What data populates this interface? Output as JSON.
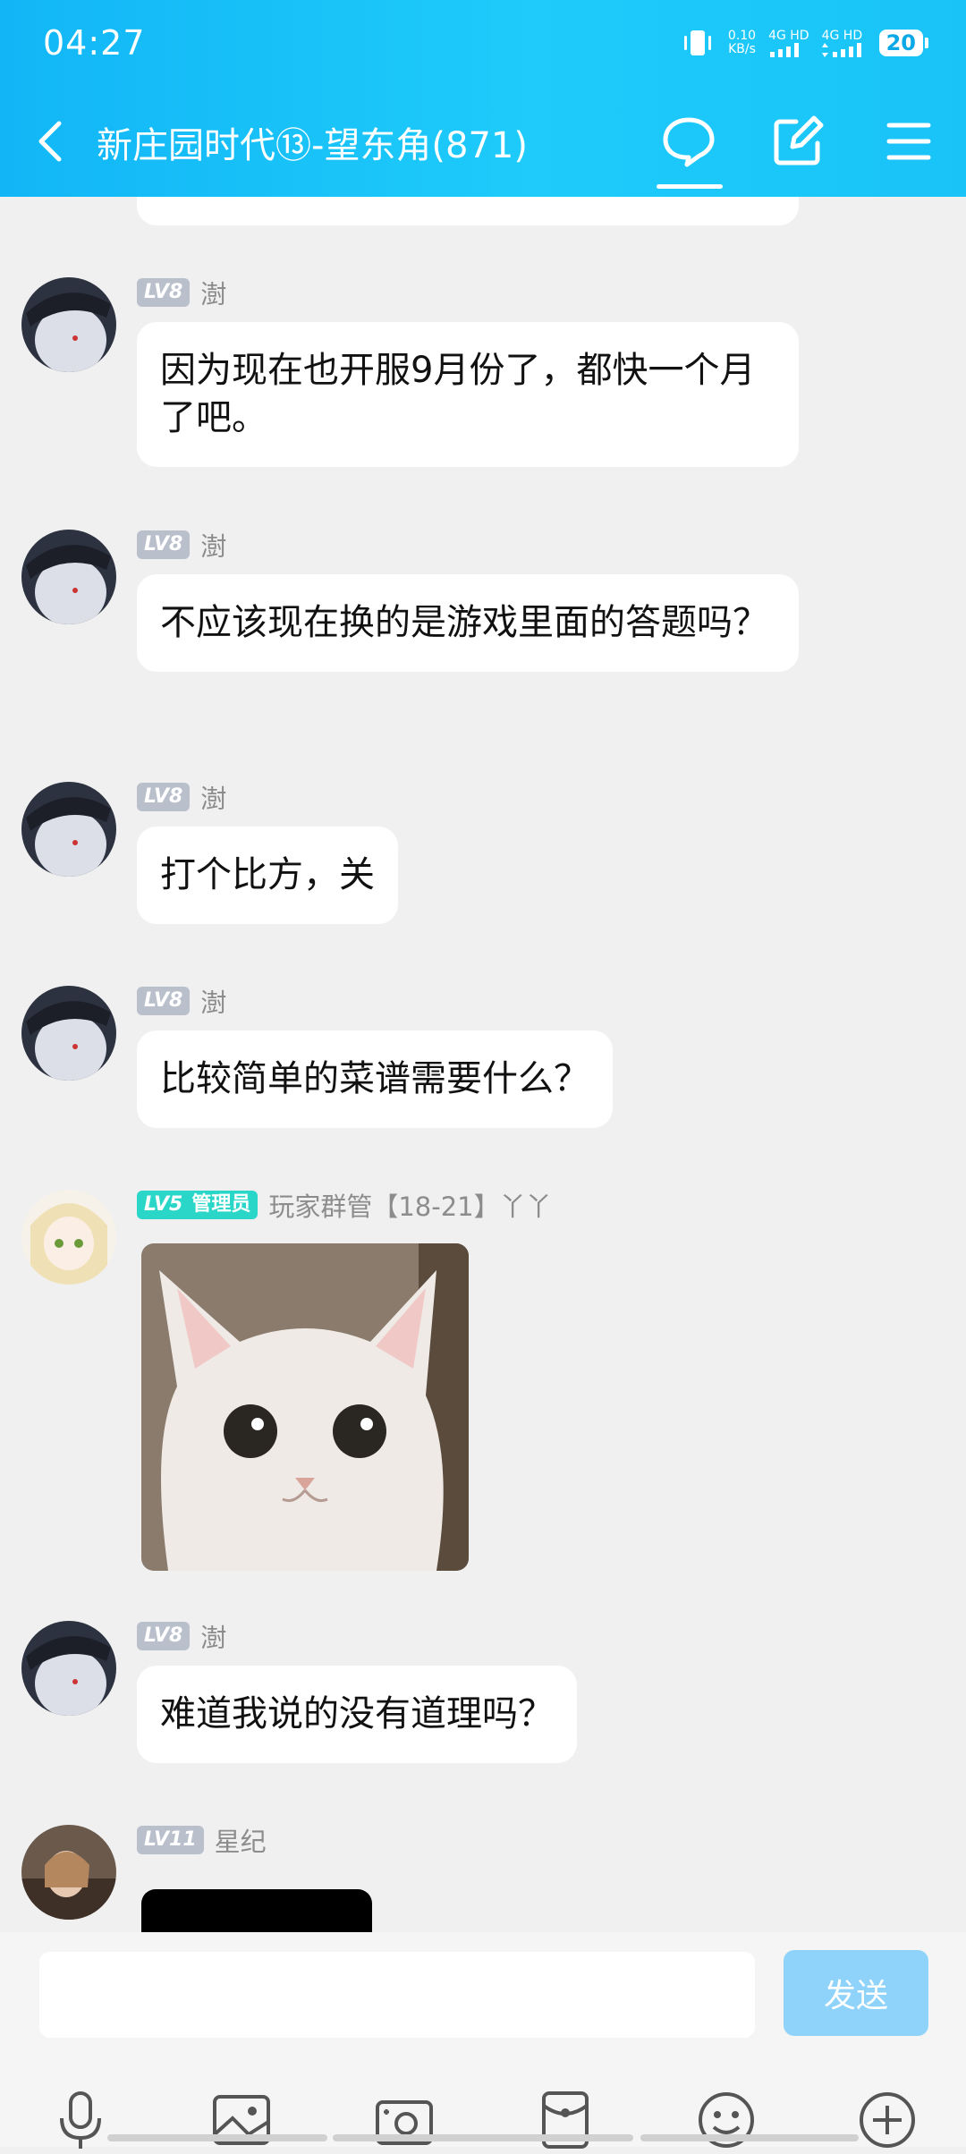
{
  "status_bar": {
    "time": "04:27",
    "speed_value": "0.10",
    "speed_unit": "KB/s",
    "net1": "4G HD",
    "net2": "4G HD",
    "battery": "20"
  },
  "header": {
    "title": "新庄园时代⑬-望东角(871)",
    "icons": [
      "back-icon",
      "chat-bubble-icon",
      "edit-icon",
      "menu-icon"
    ]
  },
  "messages": [
    {
      "level": "LV8",
      "nick": "澍",
      "text": "因为现在也开服9月份了，都快一个月了吧。"
    },
    {
      "level": "LV8",
      "nick": "澍",
      "text": "不应该现在换的是游戏里面的答题吗？"
    },
    {
      "level": "LV8",
      "nick": "澍",
      "text": "打个比方，关"
    },
    {
      "level": "LV8",
      "nick": "澍",
      "text": "比较简单的菜谱需要什么？"
    },
    {
      "level": "LV5",
      "role": "管理员",
      "nick": "玩家群管【18-21】丫丫",
      "image": "cat-photo"
    },
    {
      "level": "LV8",
      "nick": "澍",
      "text": "难道我说的没有道理吗？"
    },
    {
      "level": "LV11",
      "nick": "星纪",
      "image": "dark-image"
    }
  ],
  "input": {
    "placeholder": "",
    "send_label": "发送"
  },
  "toolbar": [
    "microphone-icon",
    "gallery-icon",
    "camera-icon",
    "red-packet-icon",
    "emoji-icon",
    "plus-icon"
  ],
  "colors": {
    "header_accent": "#1ec6f8",
    "send_button": "#8fd3fb",
    "admin_badge": "#29d6c8"
  }
}
